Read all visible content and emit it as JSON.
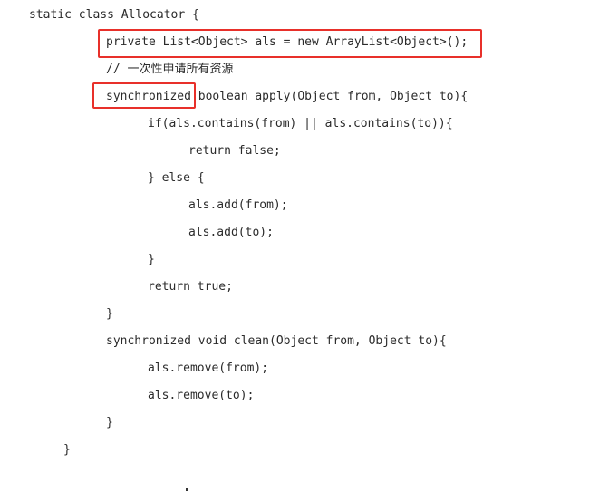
{
  "code": {
    "lines": [
      "static class Allocator {",
      "private List<Object> als = new ArrayList<Object>();",
      "// 一次性申请所有资源",
      "synchronized boolean apply(Object from, Object to){",
      "if(als.contains(from) || als.contains(to)){",
      "return false;",
      "} else {",
      "als.add(from);",
      "als.add(to);",
      "}",
      "return true;",
      "}",
      "synchronized void clean(Object from, Object to){",
      "als.remove(from);",
      "als.remove(to);",
      "}",
      "}"
    ]
  },
  "highlights": {
    "color": "#e8302a",
    "targets": [
      "private List<Object> als = new ArrayList<Object>();",
      "synchronized"
    ]
  }
}
